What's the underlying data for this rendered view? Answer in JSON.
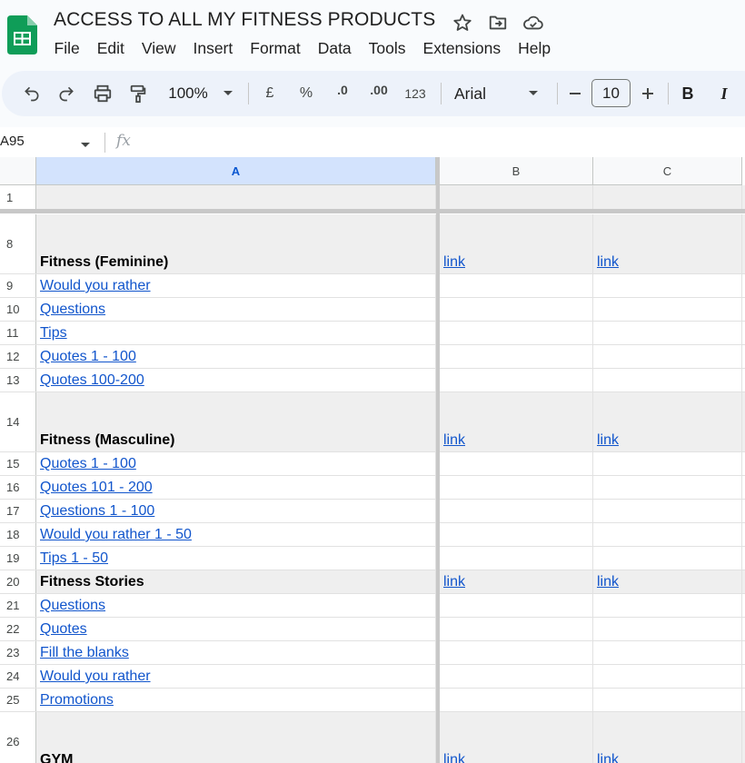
{
  "app": {
    "title": "ACCESS TO ALL MY FITNESS PRODUCTS",
    "title_icons": [
      "star-icon",
      "move-to-folder-icon",
      "cloud-status-icon"
    ]
  },
  "menu": [
    "File",
    "Edit",
    "View",
    "Insert",
    "Format",
    "Data",
    "Tools",
    "Extensions",
    "Help"
  ],
  "toolbar": {
    "zoom": "100%",
    "currency": "£",
    "percent": "%",
    "decrease_decimal": ".0",
    "increase_decimal": ".00",
    "number_format": "123",
    "font": "Arial",
    "font_size": "10",
    "bold": "B",
    "italic": "I"
  },
  "formula_bar": {
    "name_box": "A95",
    "fx": "fx"
  },
  "columns": [
    {
      "label": "A",
      "selected": true
    },
    {
      "label": "B",
      "selected": false
    },
    {
      "label": "C",
      "selected": false
    }
  ],
  "rows": [
    {
      "num": "1",
      "a": "",
      "b": "",
      "c": "",
      "kind": "header",
      "h": 27
    },
    {
      "num": "8",
      "a": "Fitness (Feminine)",
      "b": "link",
      "c": "link",
      "kind": "header",
      "h": 66
    },
    {
      "num": "9",
      "a": "Would you rather",
      "b": "",
      "c": "",
      "kind": "link",
      "h": 26
    },
    {
      "num": "10",
      "a": "Questions",
      "b": "",
      "c": "",
      "kind": "link",
      "h": 26
    },
    {
      "num": "11",
      "a": "Tips",
      "b": "",
      "c": "",
      "kind": "link",
      "h": 26
    },
    {
      "num": "12",
      "a": "Quotes 1 - 100",
      "b": "",
      "c": "",
      "kind": "link",
      "h": 26
    },
    {
      "num": "13",
      "a": "Quotes 100-200",
      "b": "",
      "c": "",
      "kind": "link",
      "h": 26
    },
    {
      "num": "14",
      "a": "Fitness (Masculine)",
      "b": "link",
      "c": "link",
      "kind": "header",
      "h": 66
    },
    {
      "num": "15",
      "a": "Quotes 1 - 100",
      "b": "",
      "c": "",
      "kind": "link",
      "h": 26
    },
    {
      "num": "16",
      "a": "Quotes 101 - 200",
      "b": "",
      "c": "",
      "kind": "link",
      "h": 26
    },
    {
      "num": "17",
      "a": "Questions 1 - 100",
      "b": "",
      "c": "",
      "kind": "link",
      "h": 26
    },
    {
      "num": "18",
      "a": "Would you rather 1 - 50",
      "b": "",
      "c": "",
      "kind": "link",
      "h": 26
    },
    {
      "num": "19",
      "a": "Tips 1 - 50",
      "b": "",
      "c": "",
      "kind": "link",
      "h": 26
    },
    {
      "num": "20",
      "a": "Fitness Stories",
      "b": "link",
      "c": "link",
      "kind": "header",
      "h": 26
    },
    {
      "num": "21",
      "a": "Questions",
      "b": "",
      "c": "",
      "kind": "link",
      "h": 26
    },
    {
      "num": "22",
      "a": "Quotes",
      "b": "",
      "c": "",
      "kind": "link",
      "h": 26
    },
    {
      "num": "23",
      "a": "Fill the blanks",
      "b": "",
      "c": "",
      "kind": "link",
      "h": 26
    },
    {
      "num": "24",
      "a": "Would you rather",
      "b": "",
      "c": "",
      "kind": "link",
      "h": 26
    },
    {
      "num": "25",
      "a": "Promotions",
      "b": "",
      "c": "",
      "kind": "link",
      "h": 26
    },
    {
      "num": "26",
      "a": "GYM",
      "b": "link",
      "c": "link",
      "kind": "header",
      "h": 66
    }
  ]
}
